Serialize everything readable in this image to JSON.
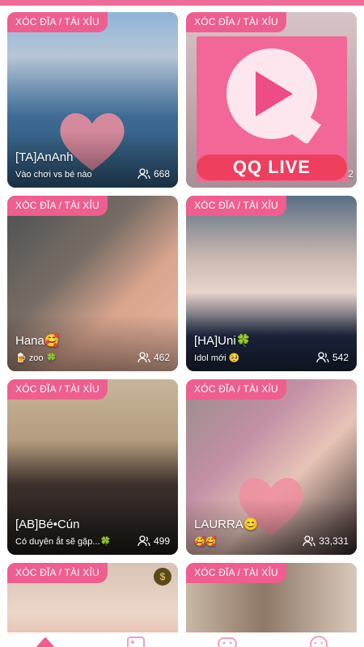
{
  "cards": [
    {
      "tag": "XÓC ĐĨA / TÀI XỈU",
      "name": "[TA]AnAnh",
      "sub": "Vào chơi vs bé nào",
      "viewers": "668"
    },
    {
      "tag": "XÓC ĐĨA / TÀI XỈU",
      "logo": "QQ LIVE",
      "viewers_partial": "2"
    },
    {
      "tag": "XÓC ĐĨA / TÀI XỈU",
      "name": "Hana🥰",
      "sub": "🍺 zoo 🍀",
      "viewers": "462"
    },
    {
      "tag": "XÓC ĐĨA / TÀI XỈU",
      "name": "[HA]Uni🍀",
      "sub": "Idol mới 🥺",
      "viewers": "542"
    },
    {
      "tag": "XÓC ĐĨA / TÀI XỈU",
      "name": "[AB]Bé•Cún",
      "sub": "Có duyên ắt sẽ gặp...🍀",
      "viewers": "499"
    },
    {
      "tag": "XÓC ĐĨA / TÀI XỈU",
      "name": "LAURRA😊",
      "sub": "🥰🥰",
      "viewers": "33,331"
    },
    {
      "tag": "XÓC ĐĨA / TÀI XỈU",
      "badge": "coin-icon"
    },
    {
      "tag": "XÓC ĐĨA / TÀI XỈU"
    }
  ],
  "colors": {
    "accent": "#ee5e8e",
    "topStrip": "#f06c98",
    "navIcon": "#f3a0bc"
  },
  "nav": [
    {
      "icon": "home-icon",
      "active": true
    },
    {
      "icon": "image-icon"
    },
    {
      "icon": "game-icon"
    },
    {
      "icon": "profile-icon"
    }
  ]
}
